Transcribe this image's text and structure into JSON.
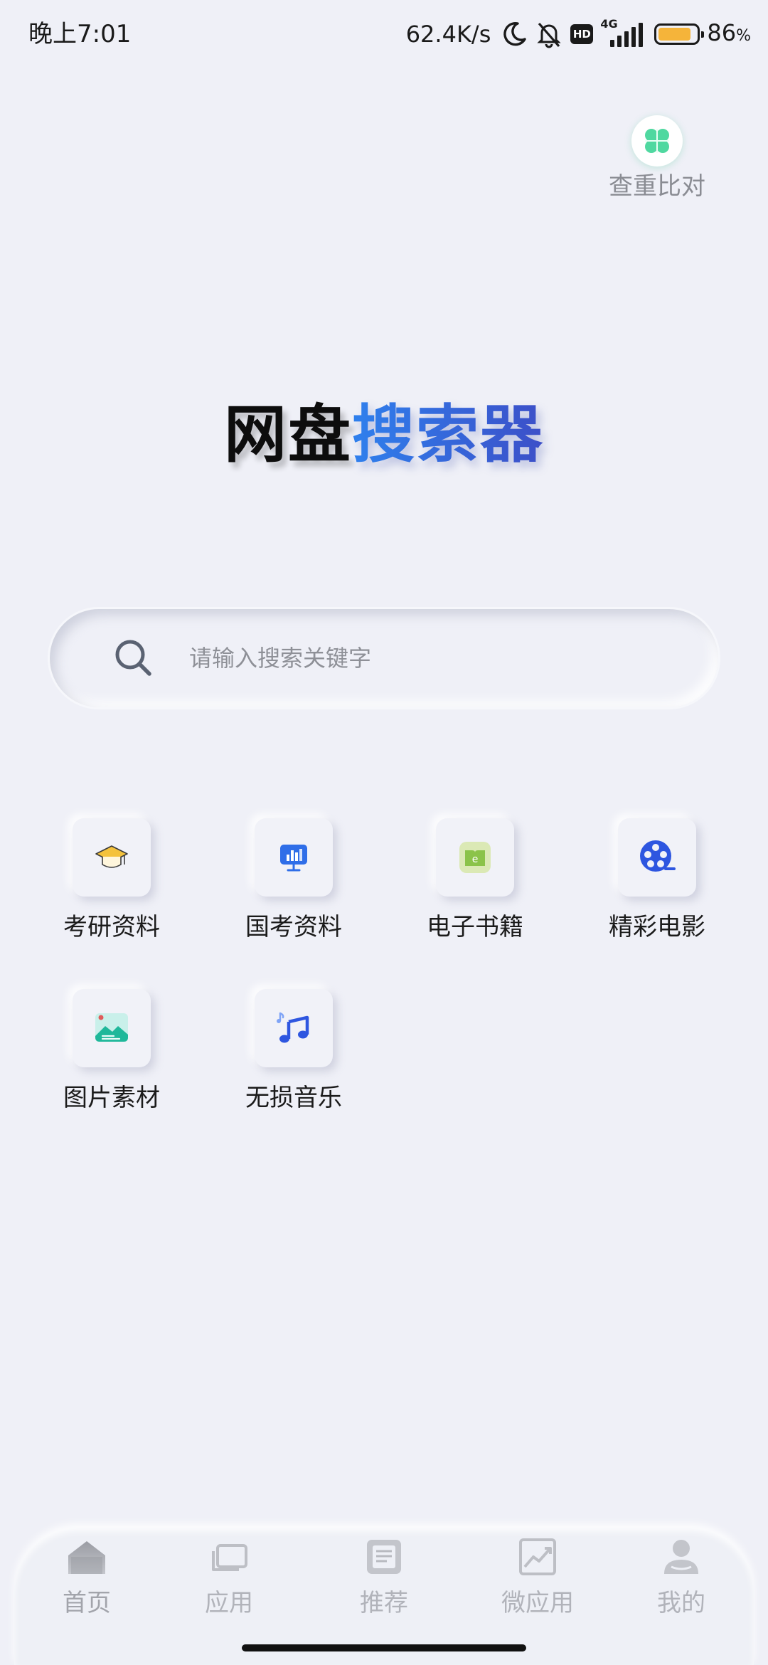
{
  "status_bar": {
    "time": "晚上7:01",
    "net_speed": "62.4K/s",
    "hd_badge": "HD",
    "network_type": "4G",
    "battery_level": 86,
    "battery_percent": "86",
    "battery_unit": "%"
  },
  "check_button": {
    "label": "查重比对",
    "icon": "clover-icon"
  },
  "title": {
    "part1": "网盘",
    "part2": "搜索器"
  },
  "search": {
    "placeholder": "请输入搜索关键字",
    "value": ""
  },
  "categories": [
    {
      "label": "考研资料",
      "icon": "graduation-cap-icon"
    },
    {
      "label": "国考资料",
      "icon": "presentation-board-icon"
    },
    {
      "label": "电子书籍",
      "icon": "ebook-icon"
    },
    {
      "label": "精彩电影",
      "icon": "film-reel-icon"
    },
    {
      "label": "图片素材",
      "icon": "image-icon"
    },
    {
      "label": "无损音乐",
      "icon": "music-note-icon"
    }
  ],
  "bottom_nav": [
    {
      "label": "首页",
      "icon": "home-icon",
      "active": true
    },
    {
      "label": "应用",
      "icon": "apps-icon"
    },
    {
      "label": "推荐",
      "icon": "recommend-icon"
    },
    {
      "label": "微应用",
      "icon": "micro-app-icon"
    },
    {
      "label": "我的",
      "icon": "profile-icon"
    }
  ],
  "colors": {
    "background": "#eff0f7",
    "title_blue_start": "#2f80ed",
    "title_blue_end": "#3c4fc8",
    "clover_green": "#4fd8a0",
    "battery": "#f5b43a",
    "nav_inactive": "#b1b3ba"
  }
}
